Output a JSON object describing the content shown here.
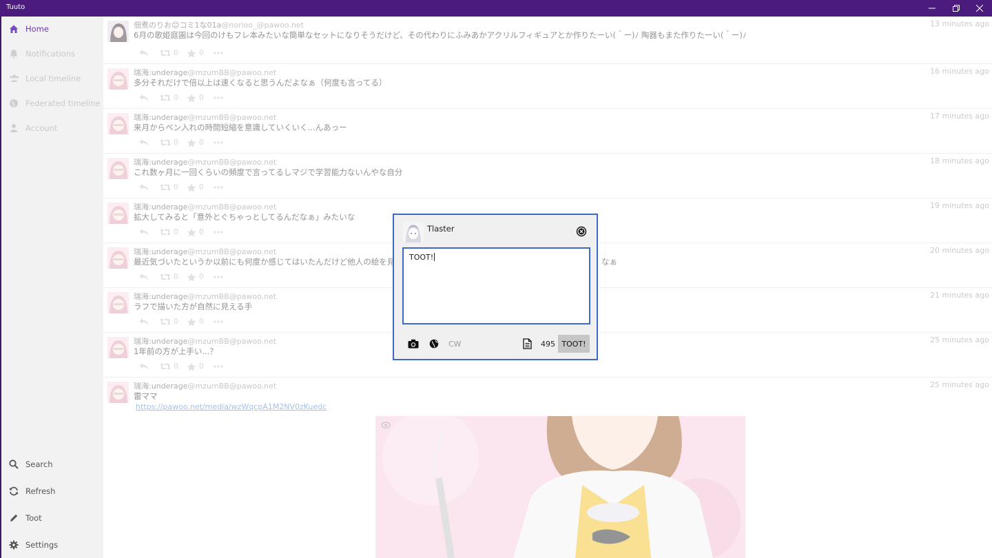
{
  "window": {
    "title": "Tuuto"
  },
  "sidebar": {
    "items": [
      {
        "label": "Home",
        "icon": "home-icon"
      },
      {
        "label": "Notifications",
        "icon": "bell-icon"
      },
      {
        "label": "Local timeline",
        "icon": "users-icon"
      },
      {
        "label": "Federated timeline",
        "icon": "globe-icon"
      },
      {
        "label": "Account",
        "icon": "user-icon"
      }
    ],
    "bottom": [
      {
        "label": "Search",
        "icon": "search-icon"
      },
      {
        "label": "Refresh",
        "icon": "refresh-icon"
      },
      {
        "label": "Toot",
        "icon": "pencil-icon"
      },
      {
        "label": "Settings",
        "icon": "gear-icon"
      }
    ]
  },
  "timeline": [
    {
      "name": "佃煮のりお",
      "emoji": "😊",
      "name_suffix": "コミ1な01a",
      "acct": "@norioo_@pawoo.net",
      "time": "13 minutes ago",
      "content": "6月の歌姫庭園は今回のけもフレ本みたいな簡単なセットになりそうだけど、その代わりにふみあかアクリルフィギュアとか作りたーい(＾ー)ﾉ 陶器もまた作りたーい(＾ー)ﾉ",
      "boosts": "0",
      "favs": "0"
    },
    {
      "name": "瑞海:underage",
      "acct": "@mzumBB@pawoo.net",
      "time": "16 minutes ago",
      "content": "多分それだけで倍以上は速くなると思うんだよなぁ（何度も言ってる）",
      "boosts": "0",
      "favs": "0"
    },
    {
      "name": "瑞海:underage",
      "acct": "@mzumBB@pawoo.net",
      "time": "17 minutes ago",
      "content": "来月からペン入れの時間短縮を意識していくいく...んあっー",
      "boosts": "0",
      "favs": "0"
    },
    {
      "name": "瑞海:underage",
      "acct": "@mzumBB@pawoo.net",
      "time": "18 minutes ago",
      "content": "これ数ヶ月に一回くらいの頻度で言ってるしマジで学習能力ないんやな自分",
      "boosts": "0",
      "favs": "0"
    },
    {
      "name": "瑞海:underage",
      "acct": "@mzumBB@pawoo.net",
      "time": "19 minutes ago",
      "content": "拡大してみると「意外とぐちゃっとしてるんだなぁ」みたいな",
      "boosts": "0",
      "favs": "0"
    },
    {
      "name": "瑞海:underage",
      "acct": "@mzumBB@pawoo.net",
      "time": "20 minutes ago",
      "content": "最近気づいたというか以前にも何度か感じてはいたんだけど他人の絵を見て",
      "content_tail": "なぁ",
      "boosts": "0",
      "favs": "0"
    },
    {
      "name": "瑞海:underage",
      "acct": "@mzumBB@pawoo.net",
      "time": "21 minutes ago",
      "content": "ラフで描いた方が自然に見える手",
      "boosts": "0",
      "favs": "0"
    },
    {
      "name": "瑞海:underage",
      "acct": "@mzumBB@pawoo.net",
      "time": "25 minutes ago",
      "content": "1年前の方が上手い...？",
      "boosts": "0",
      "favs": "0"
    },
    {
      "name": "瑞海:underage",
      "acct": "@mzumBB@pawoo.net",
      "time": "25 minutes ago",
      "content": "雷ママ",
      "link": "https://pawoo.net/media/wzWqcpA1M2NV0zKuedc"
    }
  ],
  "compose": {
    "username": "Tlaster",
    "text": "TOOT!",
    "cw_label": "CW",
    "remaining": "495",
    "submit_label": "TOOT!"
  },
  "colors": {
    "titlebar": "#4b1c7e",
    "accent": "#6d38b0",
    "dialog_border": "#3f68c6"
  }
}
